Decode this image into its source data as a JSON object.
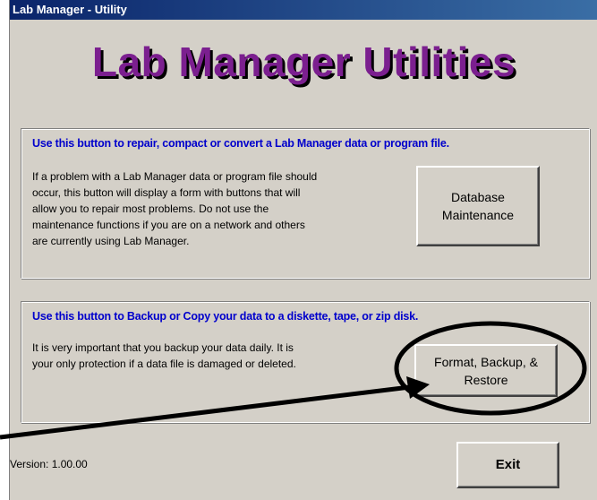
{
  "window": {
    "title": "Lab Manager - Utility"
  },
  "header": {
    "title": "Lab Manager Utilities"
  },
  "sections": [
    {
      "heading": "Use this button to repair, compact or convert a Lab Manager data or program file.",
      "body": "If a problem with a Lab Manager data or program file should\noccur, this button will display a form with buttons that will\nallow you to repair most problems.  Do not use the\nmaintenance functions if you are on a network and others\nare currently using Lab Manager.",
      "button_label": "Database\nMaintenance"
    },
    {
      "heading": "Use this button to Backup or Copy your data to a diskette, tape, or zip disk.",
      "body": "It is very important that you backup your data daily.  It is\nyour only protection if a data file is damaged or deleted.",
      "button_label": "Format, Backup, &\nRestore"
    }
  ],
  "footer": {
    "version": "Version: 1.00.00",
    "exit_label": "Exit"
  },
  "colors": {
    "title_purple": "#7b1f8f",
    "heading_blue": "#0000cc",
    "window_bg": "#d4d0c8",
    "annotation": "#000000"
  },
  "annotation": {
    "icon": "arrow-and-ellipse-highlight"
  }
}
